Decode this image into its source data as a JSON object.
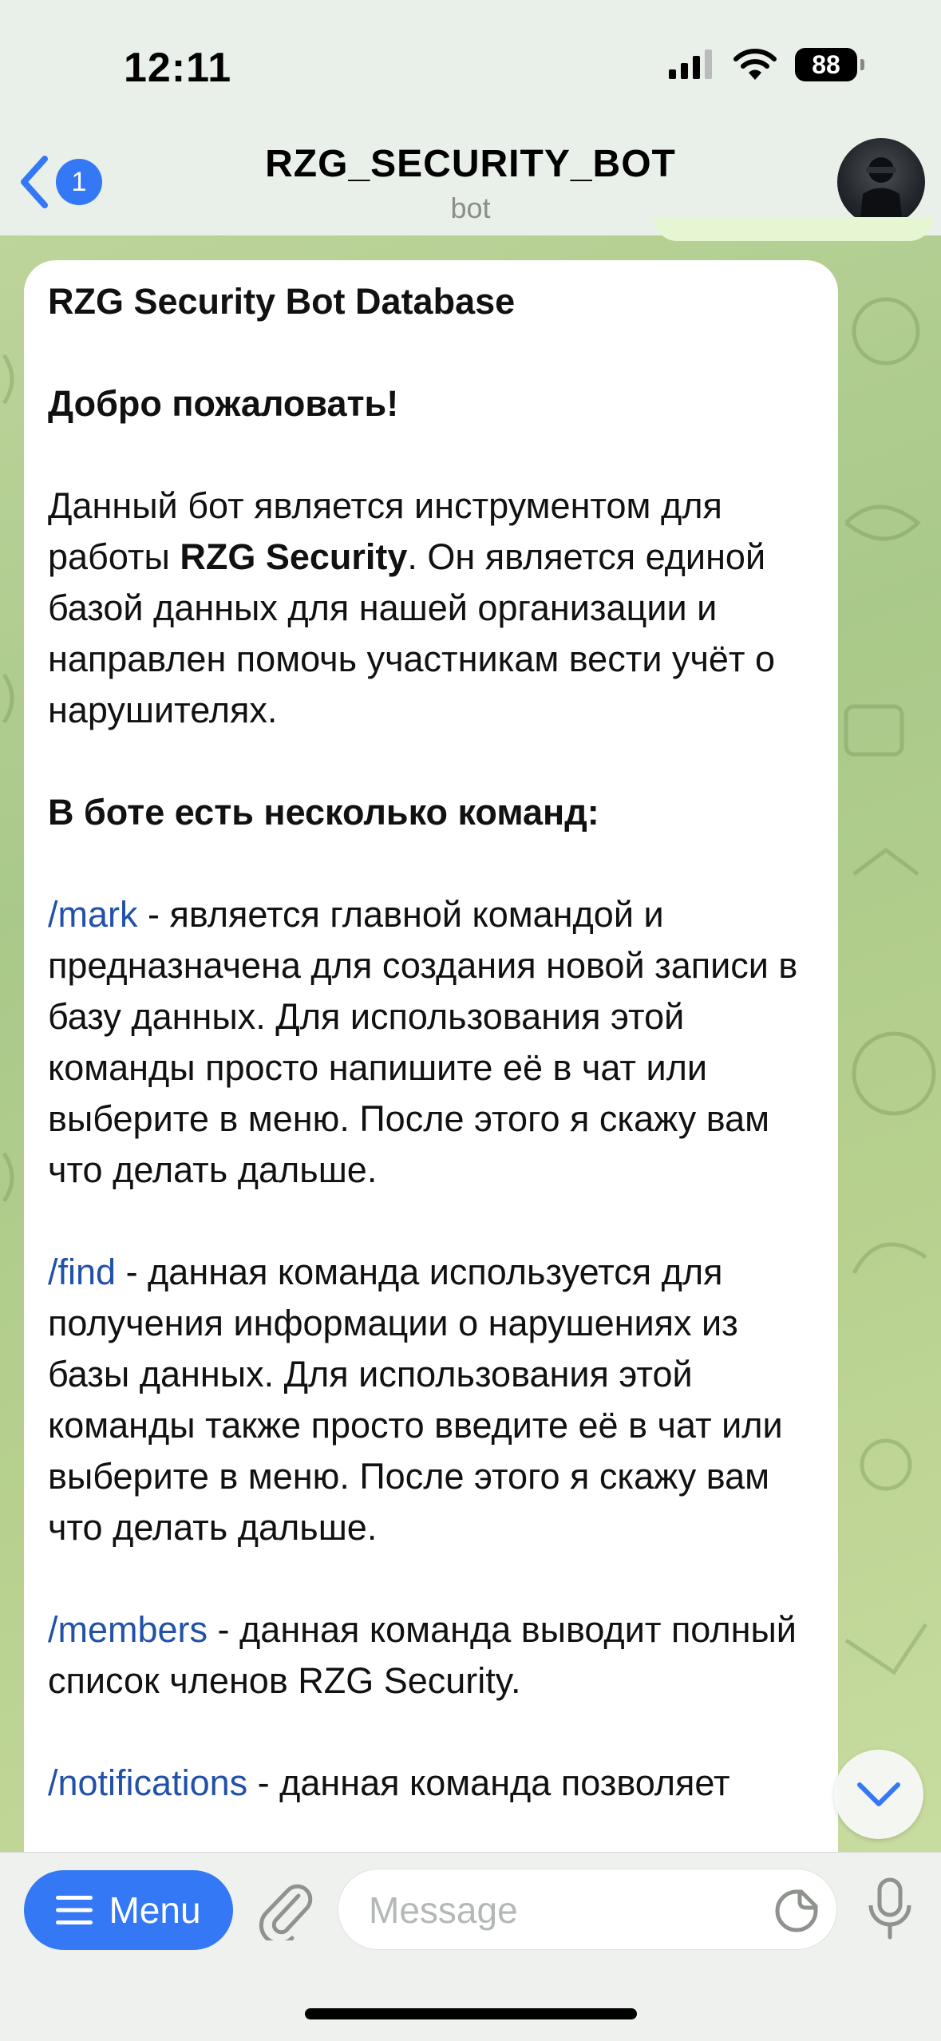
{
  "status_bar": {
    "time": "12:11",
    "battery": "88"
  },
  "header": {
    "back_badge": "1",
    "title": "RZG_SECURITY_BOT",
    "subtitle": "bot"
  },
  "message": {
    "heading": "RZG Security Bot Database",
    "welcome": "Добро пожаловать!",
    "intro_before": "Данный бот является инструментом для работы ",
    "intro_bold": "RZG Security",
    "intro_after": ". Он является единой базой данных для нашей организации и направлен помочь участникам вести учёт о нарушителях.",
    "commands_heading": "В боте есть несколько команд:",
    "commands": [
      {
        "name": "/mark",
        "description": " - является главной командой и предназначена для создания новой записи в базу данных. Для использования этой команды просто напишите её в чат или выберите в меню. После этого я скажу вам что делать дальше."
      },
      {
        "name": "/find",
        "description": " - данная команда используется для получения информации о нарушениях из базы данных. Для использования этой команды также просто введите её в чат или выберите в меню. После этого я скажу вам что делать дальше."
      },
      {
        "name": "/members",
        "description": " - данная команда выводит полный список членов RZG Security."
      },
      {
        "name": "/notifications",
        "description": " - данная команда позволяет"
      }
    ]
  },
  "input_bar": {
    "menu_label": "Menu",
    "message_placeholder": "Message"
  },
  "colors": {
    "accent": "#3478f6",
    "command_link": "#2151a8",
    "chat_bg": "#b3cf90"
  }
}
